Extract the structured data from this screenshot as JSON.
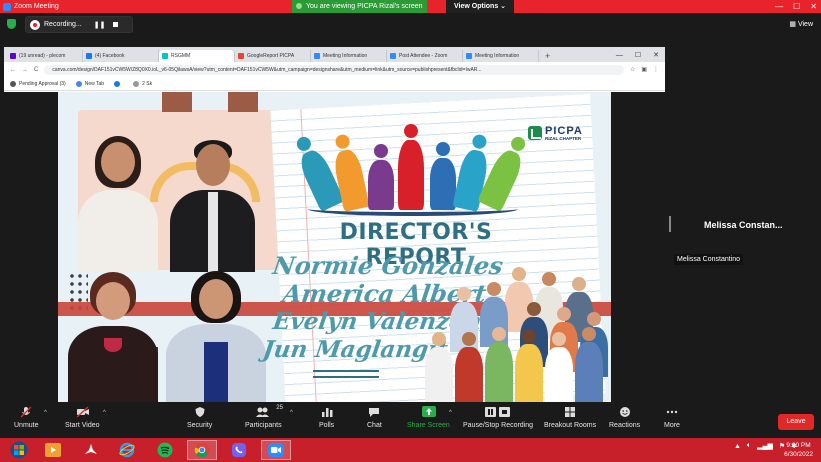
{
  "zoom": {
    "window_title": "Zoom Meeting",
    "viewing_banner": "You are viewing PICPA Rizal's screen",
    "view_options": "View Options",
    "view_options_caret": "⌄",
    "window_controls": {
      "minimize": "—",
      "maximize": "☐",
      "close": "✕"
    },
    "recording_label": "Recording...",
    "pause_icon": "❚❚",
    "view_button": "View"
  },
  "browser": {
    "tabs": [
      {
        "label": "(19 unread) - plecom",
        "color": "#6001d2"
      },
      {
        "label": "(4) Facebook",
        "color": "#1877f2"
      },
      {
        "label": "RSGMM",
        "color": "#00c4cc",
        "active": true
      },
      {
        "label": "GoogleReport PICPA",
        "color": "#ea4335"
      },
      {
        "label": "Meeting Information",
        "color": "#2d8cff"
      },
      {
        "label": "Post Attendee - Zoom",
        "color": "#2d8cff"
      },
      {
        "label": "Meeting Information",
        "color": "#2d8cff"
      }
    ],
    "new_tab": "+",
    "url": "canva.com/design/DAF151vCW5W/Z8Q0X0.ioL_v6-05QilawsA/view?utm_content=DAF151vCW5W&utm_campaign=designshare&utm_medium=link&utm_source=publishpresent&fbclid=IwAR...",
    "nav": {
      "back": "←",
      "forward": "→",
      "reload": "C"
    },
    "bookmarks": [
      {
        "label": "Pending Approval (3)",
        "color": "#555555"
      },
      {
        "label": "New Tab",
        "color": "#4285f4"
      },
      {
        "label": "",
        "color": "#1877f2"
      },
      {
        "label": "2 Sk",
        "color": "#999999"
      }
    ]
  },
  "slide": {
    "org_name": "PICPA",
    "org_chapter": "RIZAL CHAPTER",
    "title": "DIRECTOR'S REPORT",
    "names": [
      "Normie Gonzales",
      "America Albert",
      "Evelyn Valenzona",
      "Jun Maglangit"
    ]
  },
  "participant": {
    "name_display": "Melissa  Constan...",
    "name_label": "Melissa Constantino"
  },
  "toolbar": {
    "unmute": "Unmute",
    "start_video": "Start Video",
    "security": "Security",
    "participants": "Participants",
    "participants_count": "25",
    "polls": "Polls",
    "chat": "Chat",
    "share_screen": "Share Screen",
    "pause_recording": "Pause/Stop Recording",
    "breakout_rooms": "Breakout Rooms",
    "reactions": "Reactions",
    "more": "More",
    "leave": "Leave"
  },
  "taskbar": {
    "time": "9:00 PM",
    "date": "6/30/2022"
  },
  "colors": {
    "zoom_red": "#e8232b",
    "viewing_green": "#2b9a37",
    "share_green": "#2aae49",
    "slide_title": "#2f6f84",
    "slide_names": "#4f9aaa",
    "taskbar": "#c8202a"
  }
}
